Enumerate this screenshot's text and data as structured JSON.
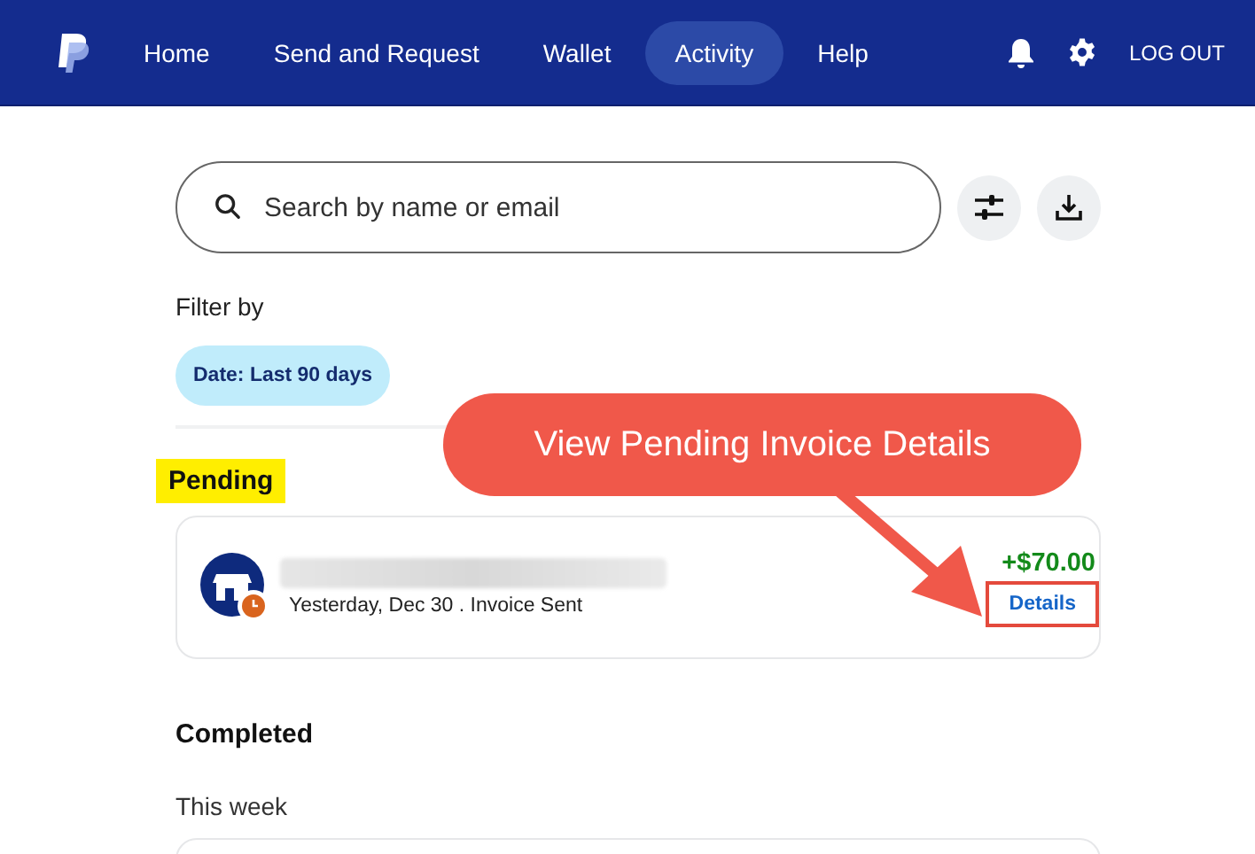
{
  "nav": {
    "items": [
      {
        "label": "Home",
        "selected": false
      },
      {
        "label": "Send and Request",
        "selected": false
      },
      {
        "label": "Wallet",
        "selected": false
      },
      {
        "label": "Activity",
        "selected": true
      },
      {
        "label": "Help",
        "selected": false
      }
    ],
    "logout": "LOG OUT"
  },
  "search": {
    "placeholder": "Search by name or email"
  },
  "filter": {
    "label": "Filter by",
    "chips": [
      {
        "label": "Date: Last 90 days"
      }
    ]
  },
  "sections": [
    {
      "title": "Pending",
      "highlighted": true,
      "items": [
        {
          "kind": "invoice",
          "detail": "Yesterday, Dec 30 . Invoice Sent",
          "amount": "+$70.00",
          "action": "Details",
          "action_boxed": true
        }
      ]
    },
    {
      "title": "Completed",
      "highlighted": false,
      "subheading": "This week",
      "items": [
        {
          "kind": "cut_off"
        }
      ]
    }
  ],
  "annotation": {
    "text": "View Pending Invoice Details"
  }
}
